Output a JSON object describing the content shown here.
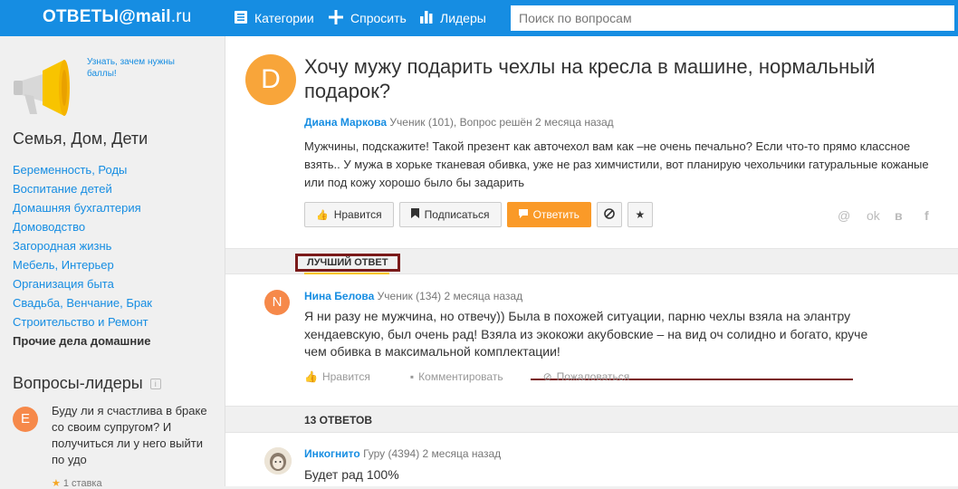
{
  "header": {
    "logo_prefix": "ОТВЕТЫ",
    "logo_at": "@",
    "logo_mail": "mail",
    "logo_ru": ".ru",
    "nav": [
      {
        "label": "Категории",
        "icon": "list-icon"
      },
      {
        "label": "Спросить",
        "icon": "plus-icon"
      },
      {
        "label": "Лидеры",
        "icon": "chart-icon"
      }
    ],
    "search_placeholder": "Поиск по вопросам"
  },
  "sidebar": {
    "promo_text": "Узнать, зачем нужны баллы!",
    "category_title": "Семья, Дом, Дети",
    "categories": [
      "Беременность, Роды",
      "Воспитание детей",
      "Домашняя бухгалтерия",
      "Домоводство",
      "Загородная жизнь",
      "Мебель, Интерьер",
      "Организация быта",
      "Свадьба, Венчание, Брак",
      "Строительство и Ремонт",
      "Прочие дела домашние"
    ],
    "active_category": "Прочие дела домашние",
    "leaders_title": "Вопросы-лидеры",
    "leader_question": {
      "avatar_letter": "E",
      "text": "Буду ли я счастлива в браке со своим супругом? И получиться ли у него выйти по удо",
      "rating": "1 ставка"
    }
  },
  "question": {
    "avatar_letter": "D",
    "title": "Хочу мужу подарить чехлы на кресла в машине, нормальный подарок?",
    "author": "Диана Маркова",
    "meta": "Ученик (101), Вопрос решён 2 месяца назад",
    "text": "Мужчины, подскажите! Такой презент как авточехол вам как –не очень печально? Если что-то прямо классное взять.. У мужа в хорьке тканевая обивка, уже не раз химчистили, вот планирую чехольчики гатуральные кожаные или под кожу хорошо было бы задарить",
    "buttons": {
      "like": "Нравится",
      "subscribe": "Подписаться",
      "answer": "Ответить"
    },
    "share": [
      "@",
      "ok",
      "в",
      "f"
    ]
  },
  "best_answer": {
    "label": "ЛУЧШИЙ ОТВЕТ",
    "avatar_letter": "N",
    "author": "Нина Белова",
    "meta": "Ученик (134) 2 месяца назад",
    "text": "Я ни разу не мужчина, но отвечу)) Была в похожей ситуации, парню чехлы взяла на элантру хендаевскую, был очень рад! Взяла из экокожи акубовские – на вид оч солидно и богато, круче чем обивка в максимальной комплектации!",
    "actions": {
      "like": "Нравится",
      "comment": "Комментировать",
      "report": "Пожаловаться"
    }
  },
  "answers": {
    "count_label": "13 ОТВЕТОВ",
    "items": [
      {
        "author": "Инкогнито",
        "meta": "Гуру (4394) 2 месяца назад",
        "text": "Будет рад 100%"
      }
    ]
  },
  "colors": {
    "header_blue": "#168de2",
    "answer_orange": "#fa9a28",
    "annotation_maroon": "#7a1a1a"
  }
}
